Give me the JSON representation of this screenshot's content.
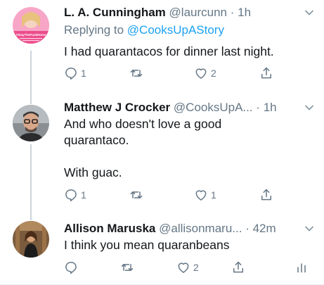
{
  "tweets": [
    {
      "name": "L. A. Cunningham",
      "handle": "@laurcunn",
      "time": "· 1h",
      "replying_prefix": "Replying to ",
      "replying_to": "@CooksUpAStory",
      "text": "I had quarantacos for dinner last night.",
      "avatar_text": "#StayTheFuckHome",
      "reply_count": "1",
      "retweet_count": "",
      "like_count": "2"
    },
    {
      "name": "Matthew J Crocker",
      "handle": "@CooksUpA...",
      "time": "· 1h",
      "text": "And who doesn't love a good\nquarantaco.\n\nWith guac.",
      "reply_count": "1",
      "retweet_count": "",
      "like_count": "1"
    },
    {
      "name": "Allison Maruska",
      "handle": "@allisonmaru...",
      "time": "· 42m",
      "text": "I think you mean quaranbeans",
      "reply_count": "",
      "retweet_count": "",
      "like_count": "2"
    }
  ],
  "icons": [
    "reply-icon",
    "retweet-icon",
    "like-icon",
    "share-icon",
    "analytics-icon",
    "chevron-down-icon"
  ],
  "colors": {
    "link": "#1da1f2",
    "secondary": "#657786",
    "thread_line": "#ccd6dd"
  }
}
